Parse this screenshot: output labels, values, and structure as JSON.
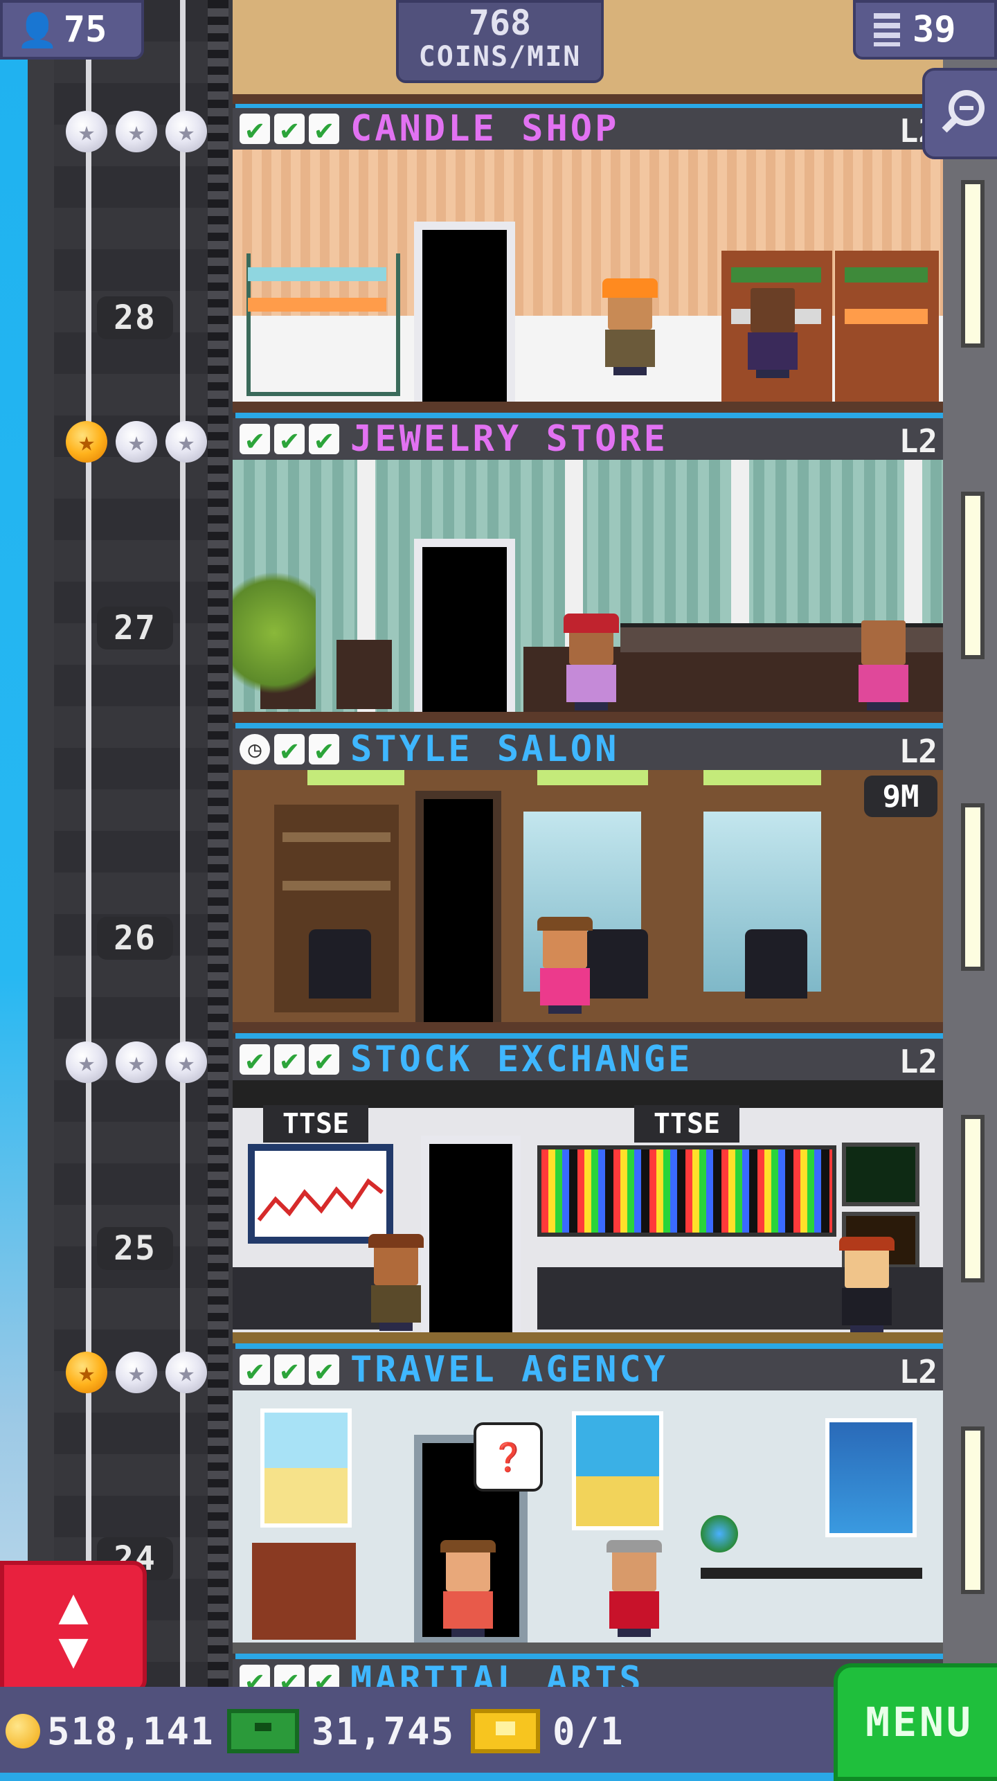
{
  "hud": {
    "population": "75",
    "coins_per_min_value": "768",
    "coins_per_min_label": "COINS/MIN",
    "floors_count": "39"
  },
  "floors": [
    {
      "name": "CANDLE SHOP",
      "level": "L2",
      "number": "28",
      "stars": 0
    },
    {
      "name": "JEWELRY STORE",
      "level": "L2",
      "number": "27",
      "stars": 1
    },
    {
      "name": "STYLE SALON",
      "level": "L2",
      "number": "26",
      "timer": "9M"
    },
    {
      "name": "STOCK EXCHANGE",
      "level": "L2",
      "number": "25",
      "stars": 0,
      "signs": [
        "TTSE",
        "TTSE"
      ]
    },
    {
      "name": "TRAVEL AGENCY",
      "level": "L2",
      "number": "24",
      "stars": 1
    },
    {
      "name": "MARTIAL ARTS"
    }
  ],
  "bottom": {
    "coins": "518,141",
    "bux": "31,745",
    "tickets": "0/1",
    "menu_label": "MENU"
  },
  "colors": {
    "pink_label": "#e272f2",
    "blue_label": "#3fb7ff",
    "menu_green": "#1fbf3c",
    "elevator_red": "#e8213e",
    "hud_purple": "#5a5a8c"
  },
  "icons": [
    "person-icon",
    "floors-icon",
    "zoom-icon",
    "coin-icon",
    "bux-icon",
    "ticket-icon",
    "elevator-arrows-icon",
    "check-icon",
    "clock-icon",
    "star-icon"
  ]
}
